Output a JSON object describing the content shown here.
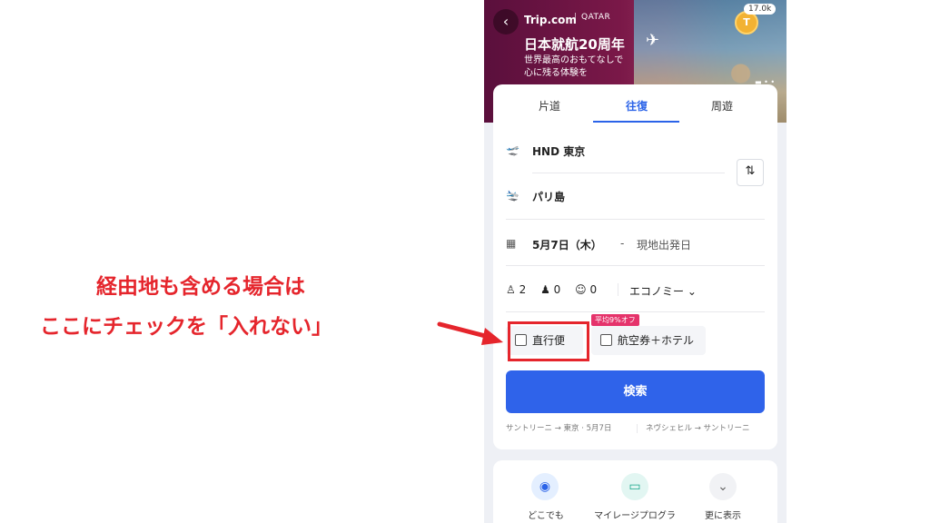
{
  "banner": {
    "brand": "Trip.com",
    "partner": "QATAR",
    "title": "日本就航20周年",
    "subtitle": "世界最高のおもてなしで\n心に残る体験を",
    "coin_letter": "T",
    "coin_count": "17.0k"
  },
  "tabs": [
    {
      "label": "片道",
      "active": false
    },
    {
      "label": "往復",
      "active": true
    },
    {
      "label": "周遊",
      "active": false
    }
  ],
  "origin": "HND 東京",
  "destination": "パリ島",
  "date": {
    "depart": "5月7日（木）",
    "dash": "-",
    "return_placeholder": "現地出発日"
  },
  "passengers": {
    "adults": "2",
    "children": "0",
    "infants": "0",
    "cabin": "エコノミー"
  },
  "options": {
    "direct": "直行便",
    "promo": "平均9%オフ",
    "bundle": "航空券＋ホテル"
  },
  "search_label": "検索",
  "recent": [
    "サントリーニ → 東京 · 5月7日",
    "ネヴシェヒル → サントリーニ"
  ],
  "quick": [
    {
      "label": "どこでも",
      "icon": "globe-icon"
    },
    {
      "label": "マイレージプログラ",
      "icon": "card-icon"
    },
    {
      "label": "更に表示",
      "icon": "chevron-down-icon"
    }
  ],
  "annotation": {
    "line1": "経由地も含める場合は",
    "line2": "ここにチェックを「入れない」"
  },
  "colors": {
    "accent": "#2f63ea",
    "annotation": "#e5252c",
    "promo": "#e5336b"
  }
}
